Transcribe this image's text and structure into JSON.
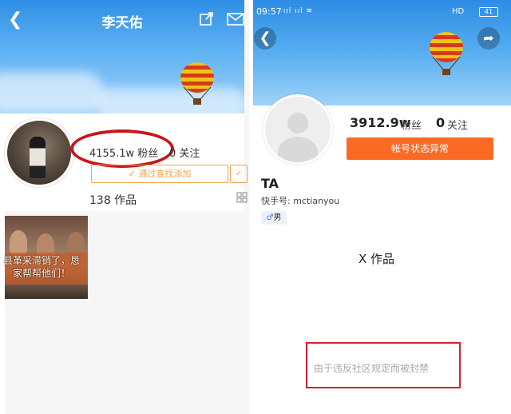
{
  "left": {
    "title": "李天佑",
    "fans": "4155.1w 粉丝",
    "follow": "0 关注",
    "add_button": "✓ 通过查找添加",
    "more_button": "✓",
    "works": "138 作品",
    "thumb_text": [
      "县革采滞销了，恳",
      "家帮帮他们！"
    ]
  },
  "right": {
    "status": {
      "time": "09:57",
      "signal": " ııl ııl ≋",
      "hd": "HD",
      "battery": "41"
    },
    "fans_count": "3912.9w",
    "fans_label": "粉丝",
    "follow_count": "0",
    "follow_label": "关注",
    "status_button": "帐号状态异常",
    "name": "TA",
    "kuaishou_id": "快手号: mctianyou",
    "gender": "男",
    "works": "X 作品",
    "ban_notice": "由于违反社区规定而被封禁"
  },
  "colors": {
    "sky_top": "#2f8fe6",
    "accent_orange": "#fb6a24",
    "highlight_red": "#c6151b",
    "outline_orange": "#f0a550"
  },
  "icons": [
    "back-arrow-icon",
    "share-icon",
    "mail-icon",
    "grid-icon",
    "hot-air-balloon",
    "gender-male-icon"
  ]
}
